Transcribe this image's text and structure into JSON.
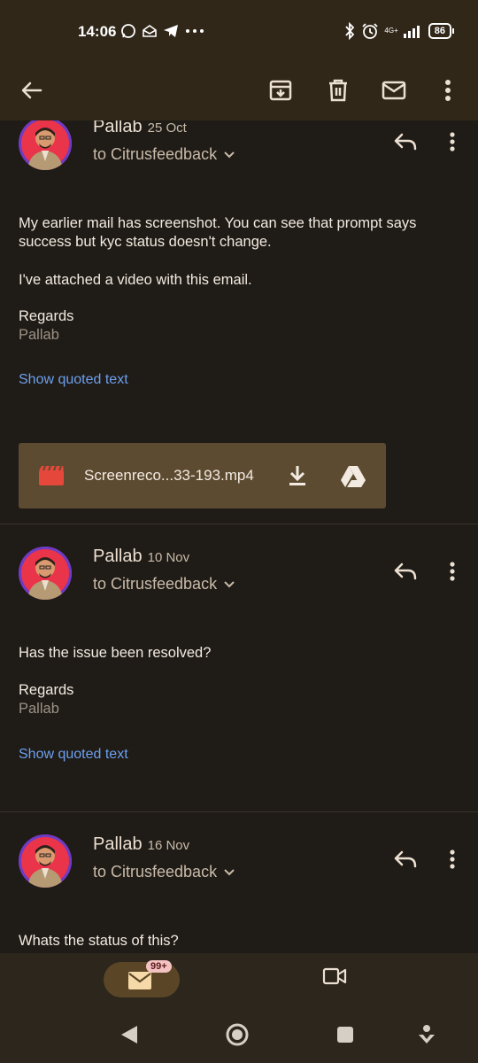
{
  "status": {
    "time": "14:06",
    "network": "4G+",
    "battery": "86"
  },
  "toolbar": {
    "back": "back-arrow-icon",
    "archive": "archive-icon",
    "delete": "trash-icon",
    "mark_unread": "mail-icon",
    "more": "more-vert-icon"
  },
  "messages": [
    {
      "sender": "Pallab",
      "date": "25 Oct",
      "to": "to Citrusfeedback",
      "body": [
        "My earlier mail has screenshot. You can see that prompt says success but kyc status doesn't change.",
        "I've attached a video with this email."
      ],
      "regards": "Regards",
      "signature": "Pallab",
      "show_quoted": "Show quoted text",
      "attachment": {
        "name": "Screenreco...33-193.mp4"
      }
    },
    {
      "sender": "Pallab",
      "date": "10 Nov",
      "to": "to Citrusfeedback",
      "body": [
        "Has the issue been resolved?"
      ],
      "regards": "Regards",
      "signature": "Pallab",
      "show_quoted": "Show quoted text"
    },
    {
      "sender": "Pallab",
      "date": "16 Nov",
      "to": "to Citrusfeedback",
      "body": [
        "Whats the status of this?"
      ]
    }
  ],
  "bottom_nav": {
    "mail_badge": "99+"
  },
  "colors": {
    "background": "#1f1b16",
    "toolbar": "#302719",
    "attachment": "#5d4b31",
    "link": "#6ca0f0",
    "video_icon": "#e5473b"
  }
}
